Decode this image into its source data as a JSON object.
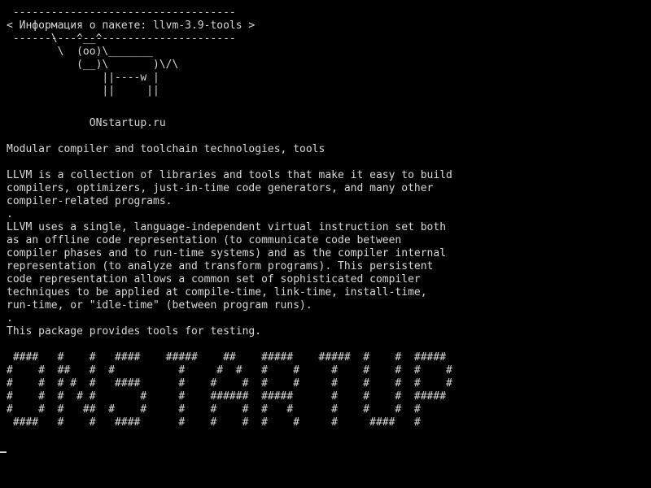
{
  "terminal": {
    "banner": [
      " -----------------------------------",
      "< Информация о пакете: llvm-3.9-tools >",
      " -----------------------------------"
    ],
    "cow": [
      "       \\   ^__^",
      "        \\  (oo)\\_______",
      "           (__)\\       )\\/\\",
      "               ||----w |",
      "               ||     ||"
    ],
    "site": "             ONstartup.ru",
    "description": [
      "Modular compiler and toolchain technologies, tools",
      "",
      "LLVM is a collection of libraries and tools that make it easy to build",
      "compilers, optimizers, just-in-time code generators, and many other",
      "compiler-related programs.",
      ".",
      "LLVM uses a single, language-independent virtual instruction set both",
      "as an offline code representation (to communicate code between",
      "compiler phases and to run-time systems) and as the compiler internal",
      "representation (to analyze and transform programs). This persistent",
      "code representation allows a common set of sophisticated compiler",
      "techniques to be applied at compile-time, link-time, install-time,",
      "run-time, or \"idle-time\" (between program runs).",
      ".",
      "This package provides tools for testing."
    ],
    "ascii_art": [
      " ####   #    #   ####    #####    ##    #####    #####  #    #  #####",
      "#    #  ##   #  #          #     #  #   #    #     #    #    #  #    #",
      "#    #  # #  #   ####      #    #    #  #    #     #    #    #  #    #",
      "#    #  #  # #       #     #    ######  #####      #    #    #  #####",
      "#    #  #   ##  #    #     #    #    #  #   #      #    #    #  #",
      " ####   #    #   ####      #    #    #  #    #     #     ####   #"
    ]
  }
}
